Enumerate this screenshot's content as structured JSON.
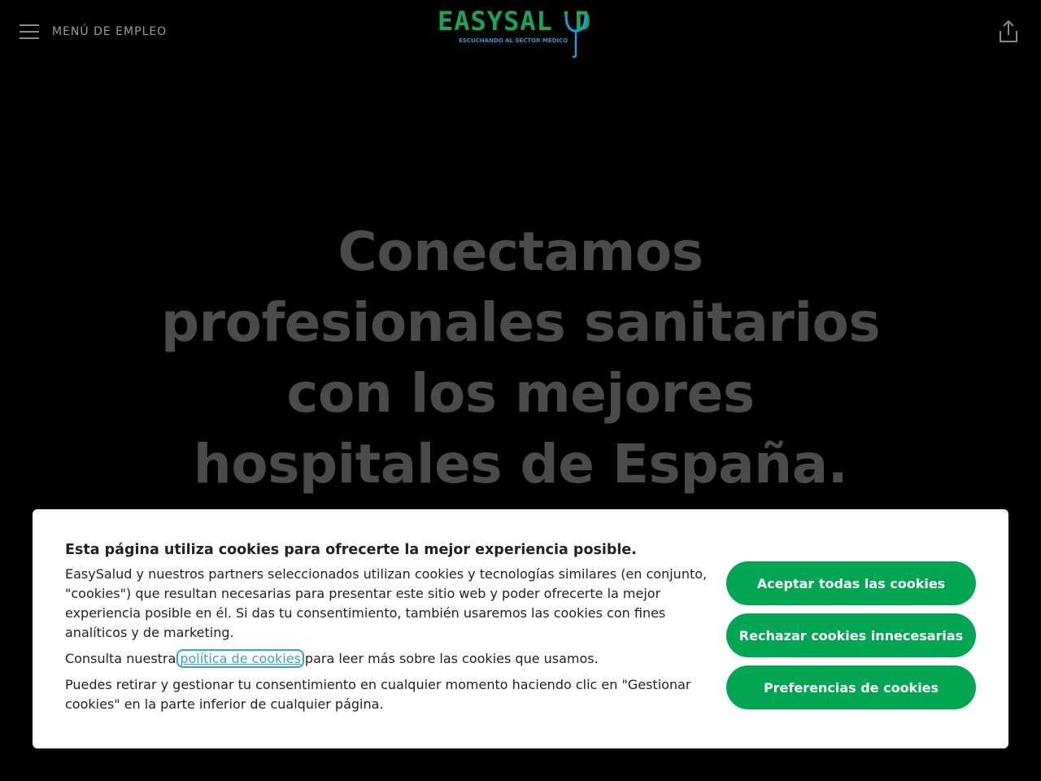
{
  "header": {
    "menu_label": "MENÚ DE EMPLEO",
    "logo_text": "EASYSAL",
    "logo_last": "D",
    "logo_tagline": "ESCUCHANDO AL SECTOR MEDICO",
    "share_icon": "share-icon"
  },
  "hero": {
    "line1": "Conectamos",
    "line2": "profesionales sanitarios",
    "line3": "con los mejores",
    "line4": "hospitales de España."
  },
  "cookies": {
    "title": "Esta página utiliza cookies para ofrecerte la mejor experiencia posible.",
    "paragraph1": "EasySalud y nuestros partners seleccionados utilizan cookies y tecnologías similares (en conjunto, \"cookies\") que resultan necesarias para presentar este sitio web y poder ofrecerte la mejor experiencia posible en él. Si das tu consentimiento, también usaremos las cookies con fines analíticos y de marketing.",
    "paragraph2_before": "Consulta nuestra",
    "policy_link": "política de cookies",
    "paragraph2_after": "para leer más sobre las cookies que usamos.",
    "paragraph3": "Puedes retirar y gestionar tu consentimiento en cualquier momento haciendo clic en \"Gestionar cookies\" en la parte inferior de cualquier página.",
    "accept_all": "Aceptar todas las cookies",
    "reject": "Rechazar cookies innecesarias",
    "preferences": "Preferencias de cookies"
  },
  "colors": {
    "background": "#000000",
    "hero_text": "#4a4a4a",
    "brand_green": "#00a651",
    "logo_blue": "#1e9ad6",
    "link": "#3aa6b9"
  }
}
